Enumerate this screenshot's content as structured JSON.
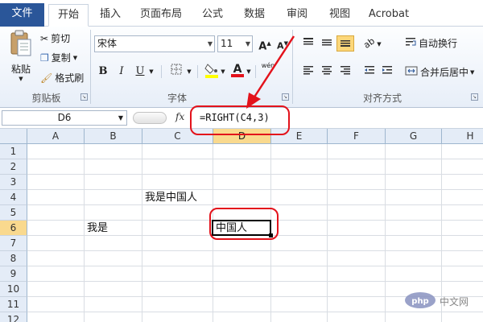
{
  "tabs": [
    {
      "label": "文件"
    },
    {
      "label": "开始"
    },
    {
      "label": "插入"
    },
    {
      "label": "页面布局"
    },
    {
      "label": "公式"
    },
    {
      "label": "数据"
    },
    {
      "label": "审阅"
    },
    {
      "label": "视图"
    },
    {
      "label": "Acrobat"
    }
  ],
  "ribbon": {
    "clipboard": {
      "paste": "粘贴",
      "cut": "剪切",
      "copy": "复制",
      "format_painter": "格式刷",
      "group_label": "剪贴板"
    },
    "font": {
      "font_name": "宋体",
      "font_size": "11",
      "grow_icon": "A",
      "shrink_icon": "A",
      "bold": "B",
      "italic": "I",
      "underline": "U",
      "font_color_letter": "A",
      "wen": "wén",
      "group_label": "字体"
    },
    "alignment": {
      "wrap_text": "自动换行",
      "merge_center": "合并后居中",
      "group_label": "对齐方式"
    }
  },
  "formula_bar": {
    "name_box": "D6",
    "fx": "fx",
    "formula": "=RIGHT(C4,3)"
  },
  "grid": {
    "columns": [
      "A",
      "B",
      "C",
      "D",
      "E",
      "F",
      "G",
      "H"
    ],
    "rows": [
      "1",
      "2",
      "3",
      "4",
      "5",
      "6",
      "7",
      "8",
      "9",
      "10",
      "11",
      "12"
    ],
    "cells": {
      "C4": "我是中国人",
      "B6": "我是",
      "D6": "中国人"
    },
    "active_cell": "D6"
  },
  "watermark": "php 中文网",
  "colors": {
    "file_tab": "#2a5699",
    "highlight_header": "#f9d98e",
    "annotation_red": "#e3121b"
  }
}
